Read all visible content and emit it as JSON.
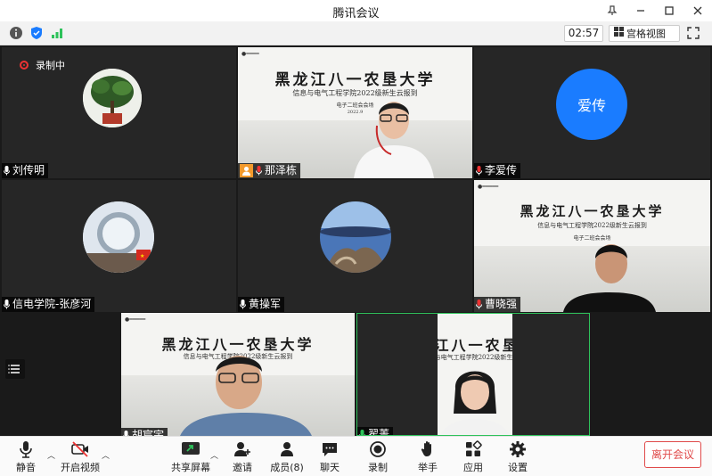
{
  "window": {
    "title": "腾讯会议"
  },
  "topbar": {
    "timer": "02:57",
    "layout_label": "宫格视图"
  },
  "recording": {
    "label": "录制中"
  },
  "slide": {
    "university": "黑龙江八一农垦大学",
    "subtitle": "信息与电气工程学院2022级新生云报到",
    "line3": "电子二班会会场",
    "date": "2022.9"
  },
  "participants": [
    {
      "name": "刘传明"
    },
    {
      "name": "那泽栋"
    },
    {
      "name": "李爱传",
      "avatar_text": "爱传"
    },
    {
      "name": "信电学院-张彦河"
    },
    {
      "name": "黄操军"
    },
    {
      "name": "曹晓强"
    },
    {
      "name": "胡宸宇"
    },
    {
      "name": "翟菁"
    }
  ],
  "toolbar": {
    "mute": "静音",
    "video": "开启视频",
    "share": "共享屏幕",
    "invite": "邀请",
    "members": "成员(8)",
    "chat": "聊天",
    "record": "录制",
    "raise": "举手",
    "apps": "应用",
    "settings": "设置",
    "leave": "离开会议"
  },
  "colors": {
    "accent": "#1a7cff",
    "leave": "#e04a4a",
    "active_speaker": "#2fc25b"
  }
}
